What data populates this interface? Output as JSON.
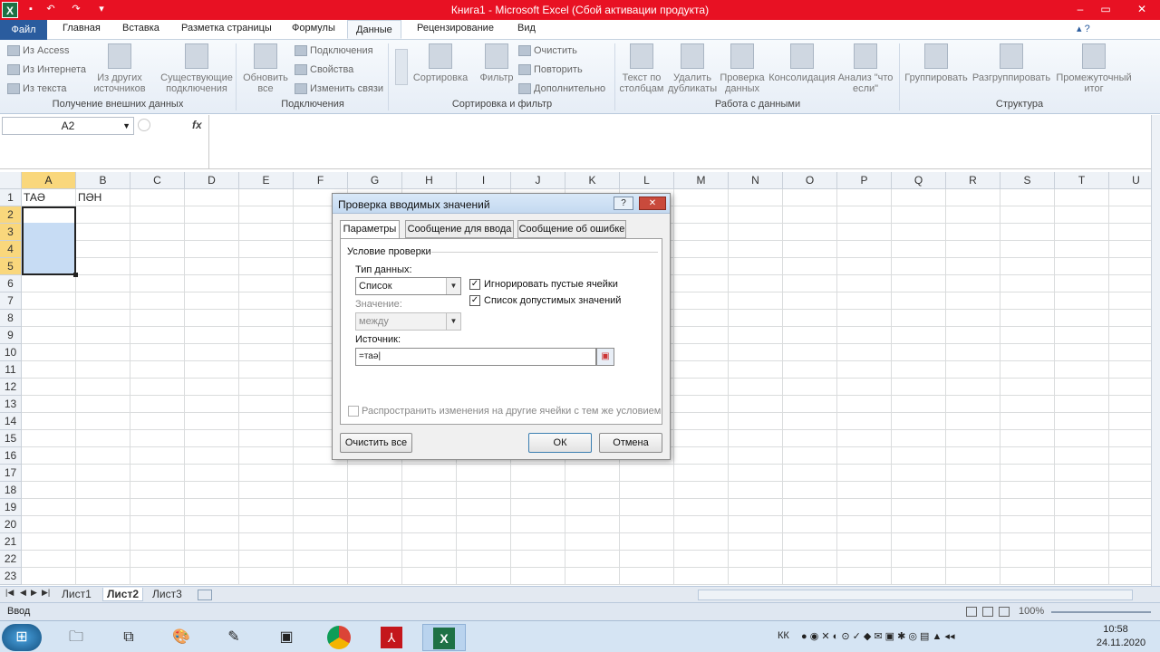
{
  "window": {
    "title": "Книга1  -  Microsoft Excel (Сбой активации продукта)"
  },
  "ribbon": {
    "tabs": [
      "Файл",
      "Главная",
      "Вставка",
      "Разметка страницы",
      "Формулы",
      "Данные",
      "Рецензирование",
      "Вид"
    ],
    "active_tab": "Данные",
    "groups": {
      "external": {
        "label": "Получение внешних данных",
        "from_access": "Из Access",
        "from_web": "Из Интернета",
        "from_text": "Из текста",
        "other_sources": "Из других источников",
        "existing": "Существующие подключения"
      },
      "connections": {
        "label": "Подключения",
        "refresh_all": "Обновить все",
        "connections": "Подключения",
        "properties": "Свойства",
        "edit_links": "Изменить связи"
      },
      "sort_filter": {
        "label": "Сортировка и фильтр",
        "sort": "Сортировка",
        "filter": "Фильтр",
        "clear": "Очистить",
        "reapply": "Повторить",
        "advanced": "Дополнительно"
      },
      "data_tools": {
        "label": "Работа с данными",
        "text_to_columns": "Текст по столбцам",
        "remove_dupes": "Удалить дубликаты",
        "validation": "Проверка данных",
        "consolidate": "Консолидация",
        "what_if": "Анализ \"что если\""
      },
      "outline": {
        "label": "Структура",
        "group": "Группировать",
        "ungroup": "Разгруппировать",
        "subtotal": "Промежуточный итог"
      }
    }
  },
  "formula_bar": {
    "name_box": "A2",
    "fx": "fx",
    "value": ""
  },
  "grid": {
    "columns": [
      "A",
      "B",
      "C",
      "D",
      "E",
      "F",
      "G",
      "H",
      "I",
      "J",
      "K",
      "L",
      "M",
      "N",
      "O",
      "P",
      "Q",
      "R",
      "S",
      "T",
      "U"
    ],
    "rows": [
      "1",
      "2",
      "3",
      "4",
      "5",
      "6",
      "7",
      "8",
      "9",
      "10",
      "11",
      "12",
      "13",
      "14",
      "15",
      "16",
      "17",
      "18",
      "19",
      "20",
      "21",
      "22",
      "23"
    ],
    "cells": {
      "A1": "ТАӘ",
      "B1": "ПӘН"
    }
  },
  "sheets": [
    "Лист1",
    "Лист2",
    "Лист3"
  ],
  "active_sheet": "Лист2",
  "status": {
    "mode": "Ввод",
    "zoom": "100%"
  },
  "dialog": {
    "title": "Проверка вводимых значений",
    "tabs": [
      "Параметры",
      "Сообщение для ввода",
      "Сообщение об ошибке"
    ],
    "section": "Условие проверки",
    "data_type_label": "Тип данных:",
    "data_type_value": "Список",
    "ignore_blank": "Игнорировать пустые ячейки",
    "in_cell_dropdown": "Список допустимых значений",
    "value_label": "Значение:",
    "value_value": "между",
    "source_label": "Источник:",
    "source_value": "=таә",
    "apply_all": "Распространить изменения на другие ячейки с тем же условием",
    "clear_all": "Очистить все",
    "ok": "ОК",
    "cancel": "Отмена"
  },
  "taskbar": {
    "lang": "КК",
    "time": "10:58",
    "date": "24.11.2020"
  }
}
